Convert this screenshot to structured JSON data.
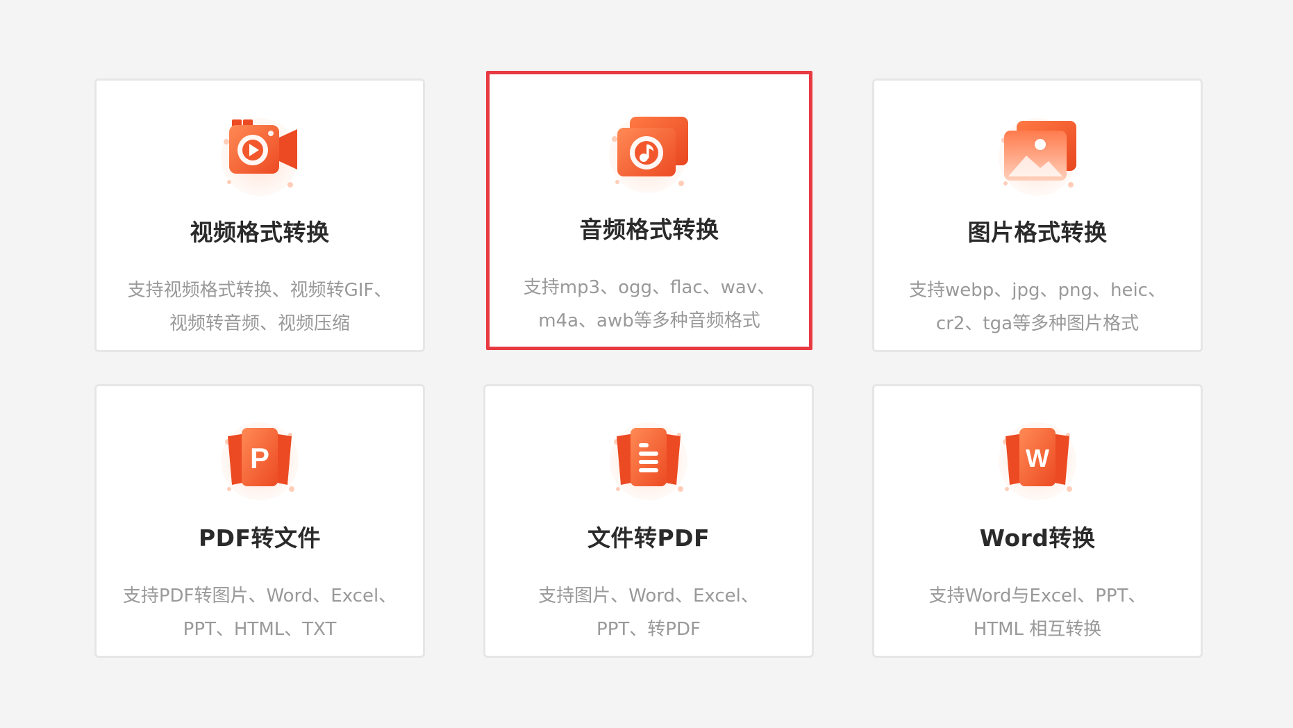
{
  "theme": {
    "accent": "#f2572e",
    "accent_light": "#ffb08c",
    "highlight_border": "#e83a42",
    "title_color": "#2a2a2a",
    "desc_color": "#999999"
  },
  "cards": [
    {
      "icon": "video-camera-icon",
      "title": "视频格式转换",
      "desc_line1": "支持视频格式转换、视频转GIF、",
      "desc_line2": "视频转音频、视频压缩",
      "selected": false
    },
    {
      "icon": "audio-note-icon",
      "title": "音频格式转换",
      "desc_line1": "支持mp3、ogg、flac、wav、",
      "desc_line2": "m4a、awb等多种音频格式",
      "selected": true
    },
    {
      "icon": "image-icon",
      "title": "图片格式转换",
      "desc_line1": "支持webp、jpg、png、heic、",
      "desc_line2": "cr2、tga等多种图片格式",
      "selected": false
    },
    {
      "icon": "powerpoint-p-icon",
      "title": "PDF转文件",
      "desc_line1": "支持PDF转图片、Word、Excel、",
      "desc_line2": "PPT、HTML、TXT",
      "selected": false
    },
    {
      "icon": "document-lines-icon",
      "title": "文件转PDF",
      "desc_line1": "支持图片、Word、Excel、",
      "desc_line2": "PPT、转PDF",
      "selected": false
    },
    {
      "icon": "word-w-icon",
      "title": "Word转换",
      "desc_line1": "支持Word与Excel、PPT、",
      "desc_line2": "HTML 相互转换",
      "selected": false
    }
  ]
}
